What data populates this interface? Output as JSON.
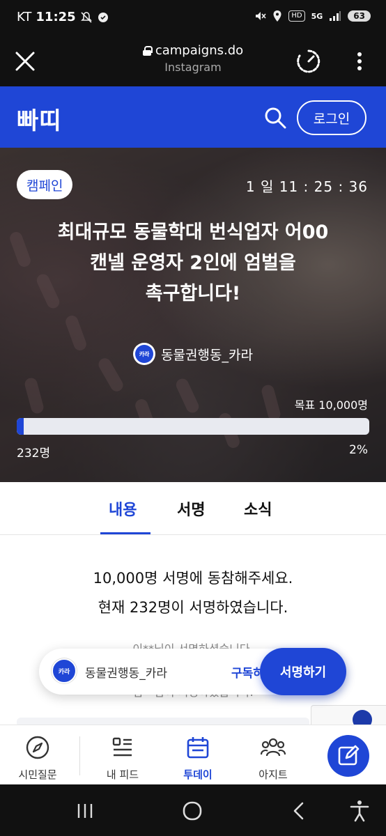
{
  "status_bar": {
    "carrier": "KT",
    "time": "11:25",
    "hd": "HD",
    "network": "5G",
    "battery": "63"
  },
  "browser": {
    "url": "campaigns.do",
    "source": "Instagram"
  },
  "header": {
    "logo": "빠띠",
    "login_label": "로그인"
  },
  "campaign": {
    "tag": "캠페인",
    "countdown": "1 일 11 : 25 : 36",
    "title_lines": [
      "최대규모 동물학대 번식업자 어00",
      "캔넬 운영자 2인에 엄벌을",
      "촉구합니다!"
    ],
    "org_name": "동물권행동_카라",
    "org_logo_text": "카라",
    "goal": "목표 10,000명",
    "current_count": "232명",
    "percent": "2%",
    "progress_fraction": 0.02
  },
  "tabs": [
    {
      "label": "내용",
      "active": true
    },
    {
      "label": "서명",
      "active": false
    },
    {
      "label": "소식",
      "active": false
    }
  ],
  "content": {
    "line1": "10,000명 서명에 동참해주세요.",
    "line2": "현재 232명이 서명하였습니다.",
    "signer_1": "이**님이 서명하셨습니다.",
    "signer_2": "김**님이 서명하셨습니다."
  },
  "float_bar": {
    "org_name": "동물권행동_카라",
    "subscribe_label": "구독하기",
    "sign_label": "서명하기",
    "logo_text": "카라"
  },
  "bottom_nav": {
    "items": [
      {
        "label": "시민질문",
        "icon": "compass-icon"
      },
      {
        "label": "내 피드",
        "icon": "feed-list-icon"
      },
      {
        "label": "투데이",
        "icon": "calendar-icon"
      },
      {
        "label": "아지트",
        "icon": "group-icon"
      }
    ],
    "active_index": 2
  },
  "colors": {
    "accent": "#1f46d6",
    "status_bar": "#111111"
  }
}
